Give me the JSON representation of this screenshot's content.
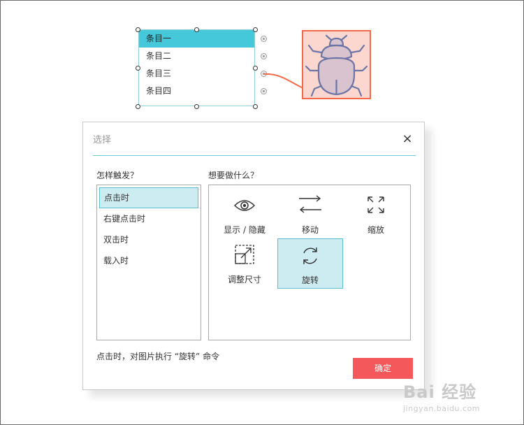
{
  "canvas": {
    "list_items": [
      "条目一",
      "条目二",
      "条目三",
      "条目四"
    ],
    "selected_list_item": 0
  },
  "dialog": {
    "title": "选择",
    "close_glyph": "×",
    "trigger_label": "怎样触发？",
    "action_label": "想要做什么？",
    "triggers": [
      "点击时",
      "右键点击时",
      "双击时",
      "载入时"
    ],
    "selected_trigger": 0,
    "actions": {
      "show_hide": "显示 / 隐藏",
      "move": "移动",
      "zoom": "缩放",
      "resize": "调整尺寸",
      "rotate": "旋转"
    },
    "selected_action": "rotate",
    "status": "点击时，对图片执行 “旋转” 命令",
    "ok_label": "确定"
  },
  "watermark": {
    "main": "Bai 经验",
    "sub": "jingyan.baidu.com"
  },
  "colors": {
    "accent_cyan": "#44c8da",
    "selection_bg": "#cdecf1",
    "ok_button": "#f4585a",
    "link_line": "#f26a4a",
    "bug_fill": "#fcd7cf",
    "bug_icon": "#6b76a6"
  }
}
